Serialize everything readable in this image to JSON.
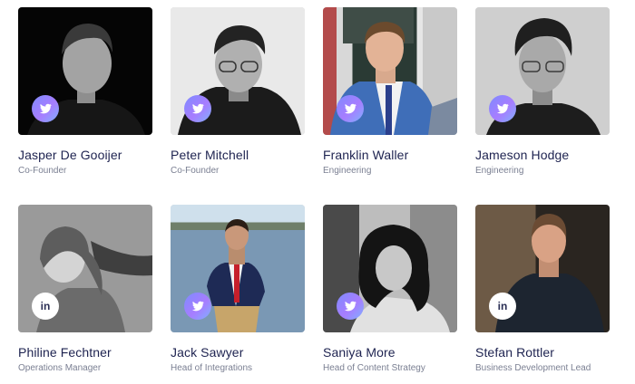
{
  "team": {
    "members": [
      {
        "name": "Jasper De Gooijer",
        "role": "Co-Founder",
        "social": "twitter-icon"
      },
      {
        "name": "Peter Mitchell",
        "role": "Co-Founder",
        "social": "twitter-icon"
      },
      {
        "name": "Franklin Waller",
        "role": "Engineering",
        "social": "twitter-icon"
      },
      {
        "name": "Jameson Hodge",
        "role": "Engineering",
        "social": "twitter-icon"
      },
      {
        "name": "Philine Fechtner",
        "role": "Operations Manager",
        "social": "linkedin-icon",
        "social_label": "in"
      },
      {
        "name": "Jack Sawyer",
        "role": "Head of Integrations",
        "social": "twitter-icon"
      },
      {
        "name": "Saniya More",
        "role": "Head of Content Strategy",
        "social": "twitter-icon"
      },
      {
        "name": "Stefan Rottler",
        "role": "Business Development Lead",
        "social": "linkedin-icon",
        "social_label": "in"
      }
    ]
  },
  "colors": {
    "name_text": "#1e2350",
    "role_text": "#7a7f92",
    "twitter_badge": "#8a86ff",
    "linkedin_badge": "#ffffff"
  }
}
